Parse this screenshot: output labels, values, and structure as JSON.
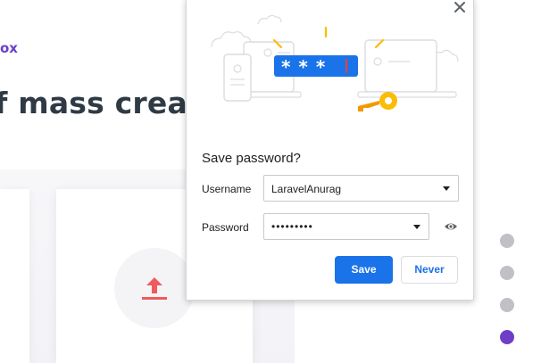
{
  "background": {
    "link_text": "ox",
    "headline": "f mass creatio",
    "upload_icon": "upload-arrow-icon",
    "upload_color": "#ef5a5e",
    "dots": [
      {
        "active": false
      },
      {
        "active": false
      },
      {
        "active": false
      },
      {
        "active": true
      }
    ],
    "accent_color": "#6e3fc6"
  },
  "dialog": {
    "close_icon": "close-icon",
    "illustration": {
      "masked_password": "* * *",
      "key_icon": "key-icon",
      "key_color": "#fbbc04"
    },
    "title": "Save password?",
    "username": {
      "label": "Username",
      "value": "LaravelAnurag"
    },
    "password": {
      "label": "Password",
      "value": "•••••••••",
      "reveal_icon": "eye-icon"
    },
    "buttons": {
      "save_label": "Save",
      "never_label": "Never"
    },
    "primary_color": "#1a73e8"
  }
}
